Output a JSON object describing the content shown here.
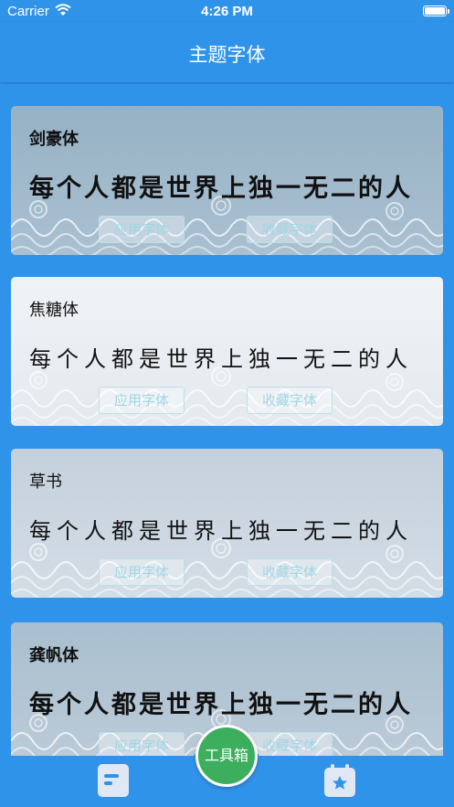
{
  "status_bar": {
    "carrier": "Carrier",
    "time": "4:26 PM"
  },
  "nav": {
    "title": "主题字体"
  },
  "cards": [
    {
      "font_name": "剑豪体",
      "sample": "每个人都是世界上独一无二的人",
      "apply_label": "应用字体",
      "collect_label": "收藏字体"
    },
    {
      "font_name": "焦糖体",
      "sample": "每个人都是世界上独一无二的人",
      "apply_label": "应用字体",
      "collect_label": "收藏字体"
    },
    {
      "font_name": "草书",
      "sample": "每个人都是世界上独一无二的人",
      "apply_label": "应用字体",
      "collect_label": "收藏字体"
    },
    {
      "font_name": "龚帆体",
      "sample": "每个人都是世界上独一无二的人",
      "apply_label": "应用字体",
      "collect_label": "收藏字体"
    }
  ],
  "tab_bar": {
    "left_icon": "document-icon",
    "center_label": "工具箱",
    "right_icon": "calendar-star-icon"
  },
  "colors": {
    "primary": "#2f93ea",
    "fab": "#3cae5e",
    "button_text": "#9fd7e6"
  }
}
